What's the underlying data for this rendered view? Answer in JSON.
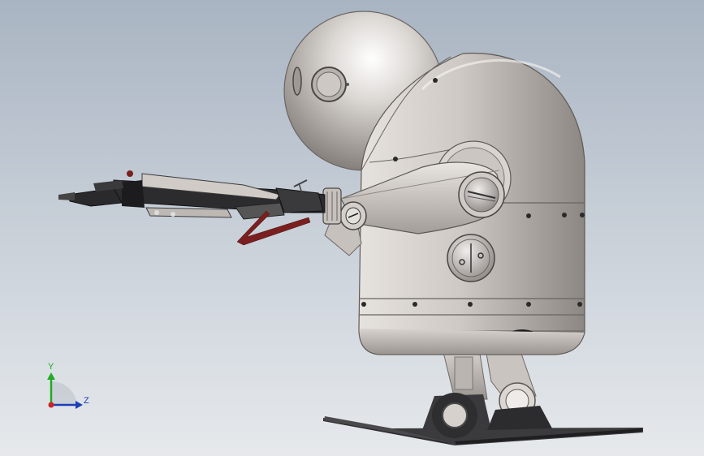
{
  "viewport": {
    "background_top": "#a9b4c2",
    "background_bottom": "#e6e9ec"
  },
  "model": {
    "body_color": "#cfcac6",
    "dark_part_color": "#3a3a3c",
    "accent_color": "#7a1f1f"
  },
  "triad": {
    "y_label": "Y",
    "z_label": "Z",
    "y_color": "#22aa22",
    "z_color": "#1a3fb5",
    "x_color": "#cc2222"
  }
}
